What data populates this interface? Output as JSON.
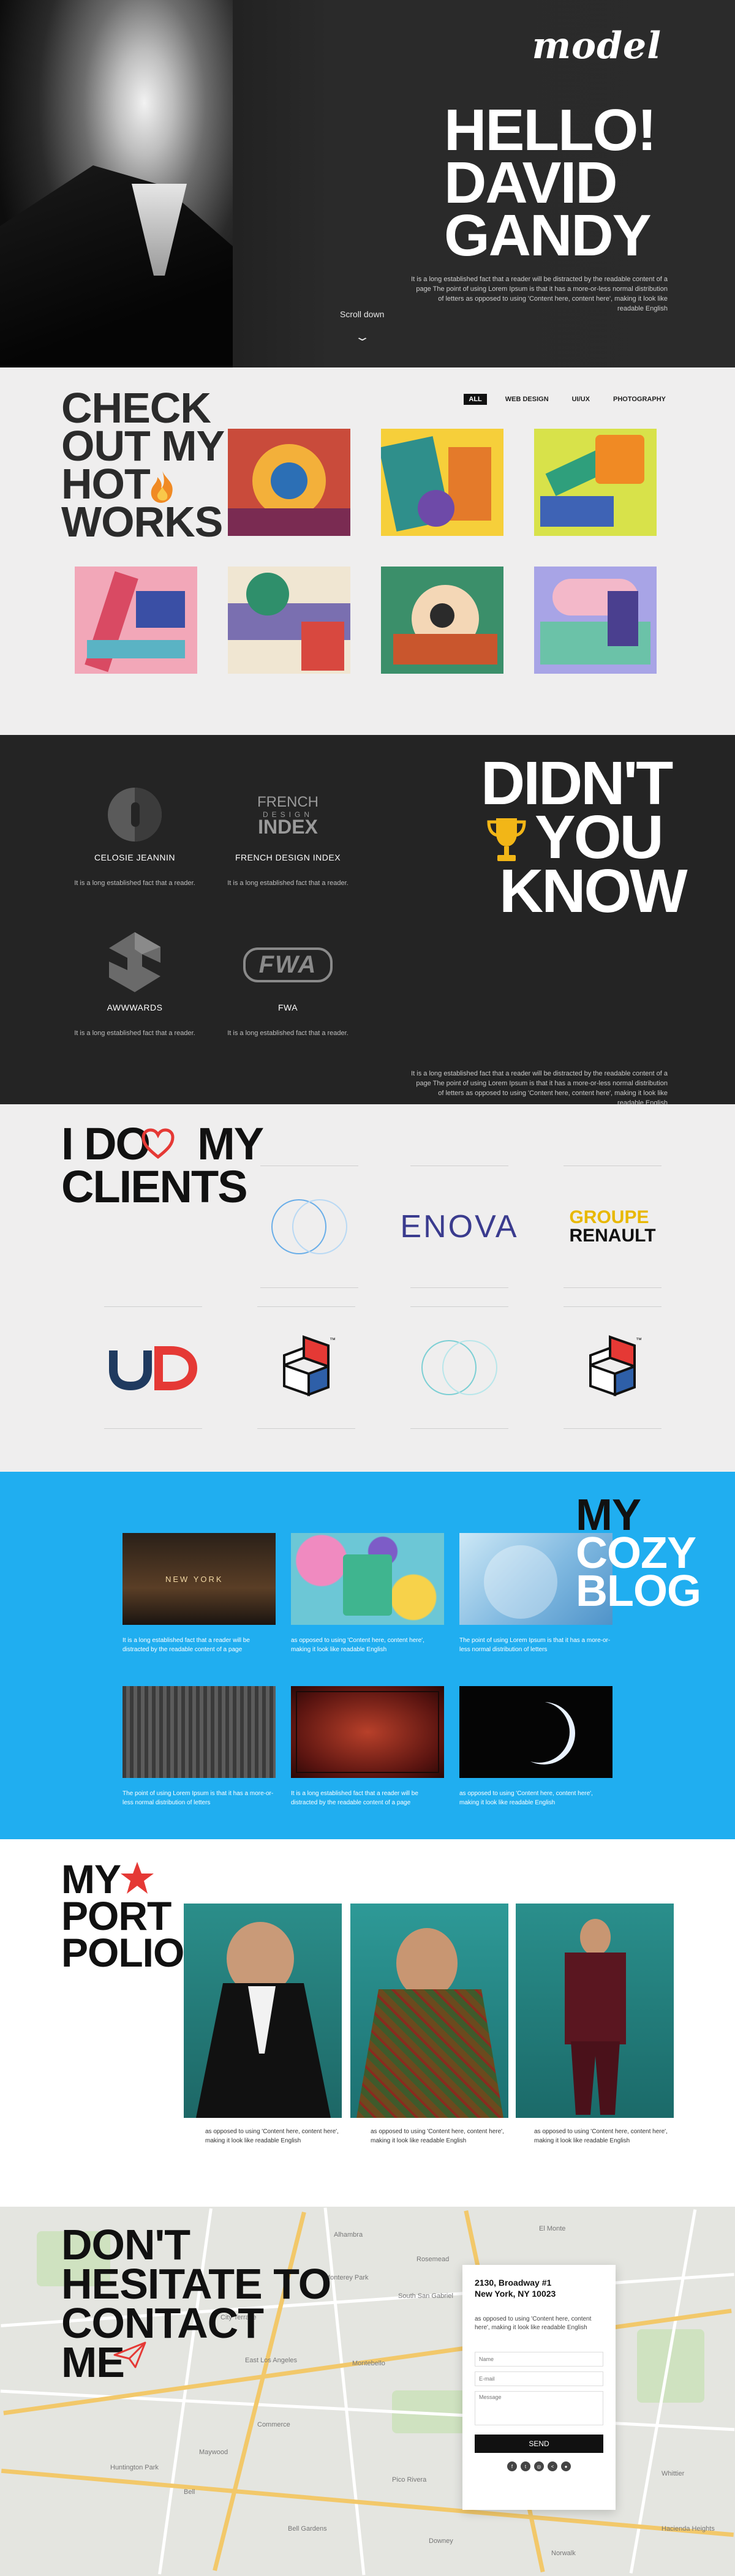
{
  "hero": {
    "logo": "model",
    "title_line1": "HELLO!",
    "title_line2": "DAVID",
    "title_line3": "GANDY",
    "description": "It is a long established fact that a reader will be distracted by the readable content of a page The point of using Lorem Ipsum is that it has a more-or-less normal distribution of letters as opposed to using 'Content here, content here', making it look like readable English",
    "scroll_label": "Scroll down"
  },
  "works": {
    "title_line1": "CHECK",
    "title_line2": "OUT MY",
    "title_line3": "HOT",
    "title_line4": "WORKS",
    "filters": [
      "ALL",
      "WEB DESIGN",
      "UI/UX",
      "PHOTOGRAPHY"
    ],
    "active_filter": "ALL"
  },
  "awards": {
    "items": [
      {
        "name": "CELOSIE JEANNIN",
        "desc": "It is a long established fact that a reader."
      },
      {
        "name": "FRENCH DESIGN INDEX",
        "desc": "It is a long established fact that a reader.",
        "logo_text_1": "FRENCH",
        "logo_text_2": "DESIGN",
        "logo_text_3": "INDEX"
      },
      {
        "name": "AWWWARDS",
        "desc": "It is a long established fact that a reader."
      },
      {
        "name": "FWA",
        "desc": "It is a long established fact that a reader.",
        "logo_text": "FWA"
      }
    ],
    "title_line1": "DIDN'T",
    "title_line2": "YOU",
    "title_line3": "KNOW",
    "description": "It is a long established fact that a reader will be distracted by the readable content of a page The point of using Lorem Ipsum is that it has a more-or-less normal distribution of letters as opposed to using 'Content here, content here', making it look like readable English"
  },
  "clients": {
    "title_line1a": "I DO",
    "title_line1b": "MY",
    "title_line2": "CLIENTS",
    "enova": "ENOVA",
    "groupe": "GROUPE",
    "renault": "RENAULT"
  },
  "blog": {
    "title_line1": "MY",
    "title_line2": "COZY",
    "title_line3": "BLOG",
    "posts": [
      {
        "text": "It is a long established fact that a reader will be distracted by the readable content of a page",
        "img_text": "NEW YORK"
      },
      {
        "text": "as opposed to using 'Content here, content here', making it look like readable English"
      },
      {
        "text": "The point of using Lorem Ipsum is that it has a more-or-less normal distribution of letters"
      },
      {
        "text": "The point of using Lorem Ipsum is that it has a more-or-less normal distribution of letters"
      },
      {
        "text": "It is a long established fact that a reader will be distracted by the readable content of a page"
      },
      {
        "text": "as opposed to using 'Content here, content here', making it look like readable English"
      }
    ]
  },
  "portfolio": {
    "title_line1": "MY",
    "title_line2": "PORT",
    "title_line3": "POLIO",
    "captions": [
      "as opposed to using 'Content here, content here', making it look like readable English",
      "as opposed to using 'Content here, content here', making it look like readable English",
      "as opposed to using 'Content here, content here', making it look like readable English"
    ]
  },
  "contact": {
    "title_line1": "DON'T",
    "title_line2": "HESITATE TO",
    "title_line3": "CONTACT",
    "title_line4": "ME",
    "address_line1": "2130, Broadway #1",
    "address_line2": "New York, NY 10023",
    "subtext": "as opposed to using 'Content here, content here', making it look like readable English",
    "name_placeholder": "Name",
    "email_placeholder": "E-mail",
    "message_placeholder": "Message",
    "send_label": "SEND",
    "map_labels": [
      "Alhambra",
      "Monterey Park",
      "Montebello",
      "City Terrace",
      "East Los Angeles",
      "Commerce",
      "Huntington Park",
      "Maywood",
      "Bell",
      "Pico Rivera",
      "Whittier",
      "Hacienda Heights",
      "South San Gabriel",
      "Rosemead",
      "Bell Gardens",
      "Downey",
      "Norwalk",
      "El Monte"
    ]
  },
  "colors": {
    "hero_bg": "#2b2b2b",
    "works_bg": "#efeeee",
    "awards_bg": "#242424",
    "blog_bg": "#20aef0",
    "accent_red": "#e53935",
    "accent_yellow": "#e8b800"
  }
}
